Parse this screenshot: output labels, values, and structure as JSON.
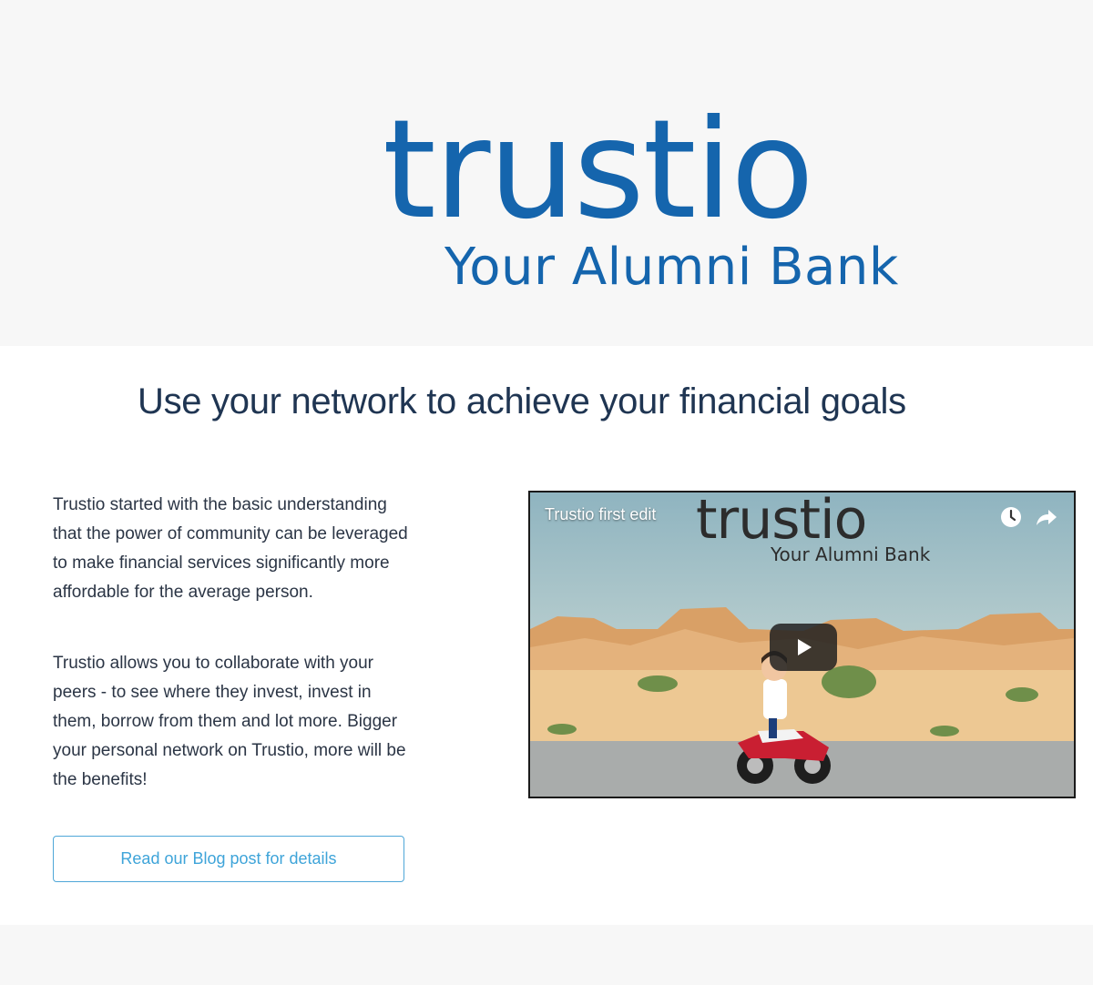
{
  "hero": {
    "logo": "trustio",
    "tagline": "Your Alumni Bank"
  },
  "main": {
    "headline": "Use your network to achieve your financial goals",
    "paragraph_1": "Trustio started with the basic understanding that the power of community can be leveraged to make financial services significantly more affordable for the average person.",
    "paragraph_2": "Trustio allows you to collaborate with your peers - to see where they invest, invest in them, borrow from them and lot more. Bigger your personal network on Trustio, more will be the benefits!",
    "blog_button_label": "Read our Blog post for details"
  },
  "video": {
    "title": "Trustio first edit",
    "thumbnail_logo": "trustio",
    "thumbnail_tagline": "Your Alumni Bank",
    "icons": [
      "clock-icon",
      "share-icon",
      "play-icon"
    ]
  },
  "colors": {
    "brand_blue": "#1565ad",
    "headline_navy": "#1f3552",
    "button_accent": "#3ea4d9",
    "hero_background": "#f7f7f7"
  }
}
